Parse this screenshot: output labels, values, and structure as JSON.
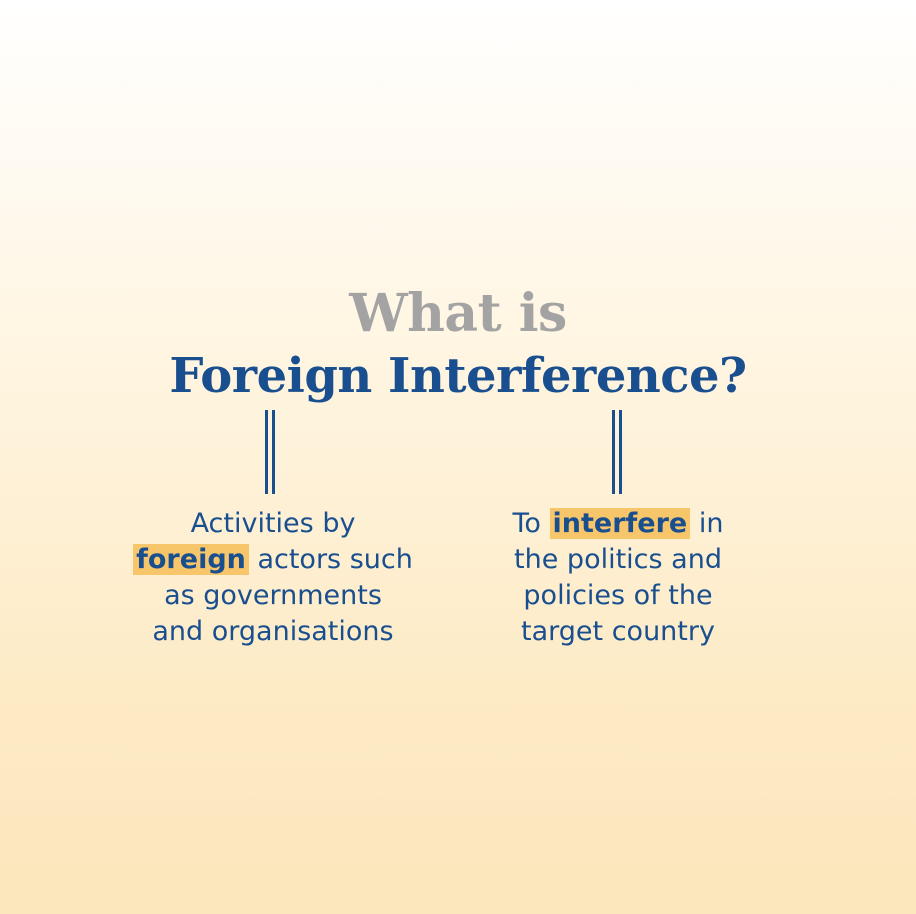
{
  "title": {
    "line1": "What is",
    "line2": "Foreign Interference?"
  },
  "definitions": [
    {
      "line1": "Activities by",
      "line2_highlight": "foreign",
      "line2_rest": " actors such",
      "line3": "as governments",
      "line4": "and organisations"
    },
    {
      "line1_pre": "To ",
      "line1_highlight": "interfere",
      "line1_post": " in",
      "line2": "the politics and",
      "line3": "policies of the",
      "line4": "target country"
    }
  ],
  "colors": {
    "title_grey": "#a3a3a3",
    "navy": "#1a4f8f",
    "highlight": "#f8c66a",
    "background_bottom": "#fce6bb"
  }
}
